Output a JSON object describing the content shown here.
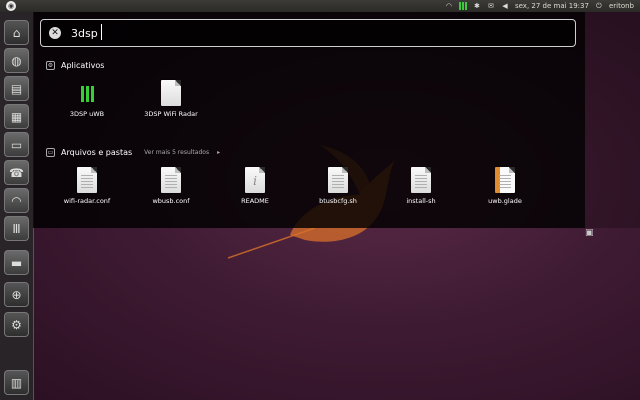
{
  "top_panel": {
    "datetime": "sex, 27 de mai 19:37",
    "user": "eritonb",
    "icons": [
      "network-icon",
      "signal-bars-icon",
      "bluetooth-icon",
      "mail-icon",
      "volume-icon",
      "power-icon"
    ]
  },
  "launcher": {
    "items": [
      "ubuntu-home-icon",
      "firefox-icon",
      "writer-icon",
      "calc-icon",
      "impress-icon",
      "phone-icon",
      "wireless-icon",
      "bars-app-icon",
      "terminal-icon",
      "zoom-icon",
      "settings-icon",
      "trash-icon"
    ]
  },
  "search": {
    "value": "3dsp"
  },
  "sections": {
    "apps": {
      "title": "Aplicativos",
      "items": [
        {
          "label": "3DSP uWB",
          "icon": "signal-bars-icon"
        },
        {
          "label": "3DSP WiFi Radar",
          "icon": "document-icon"
        }
      ]
    },
    "files": {
      "title": "Arquivos e pastas",
      "see_more": "Ver mais 5 resultados",
      "items": [
        {
          "label": "wifi-radar.conf",
          "icon": "text-document-icon"
        },
        {
          "label": "wbusb.conf",
          "icon": "text-document-icon"
        },
        {
          "label": "README",
          "icon": "info-document-icon"
        },
        {
          "label": "btusbcfg.sh",
          "icon": "text-document-icon"
        },
        {
          "label": "install-sh",
          "icon": "text-document-icon"
        },
        {
          "label": "uwb.glade",
          "icon": "glade-document-icon"
        }
      ]
    }
  },
  "colors": {
    "desktop": "#3f1b33",
    "dash_bg": "#000000",
    "accent_green": "#35d035",
    "narwhal_orange": "#d9702a"
  }
}
